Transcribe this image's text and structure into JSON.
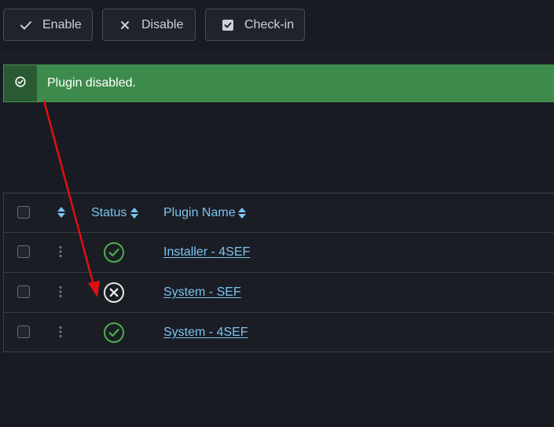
{
  "toolbar": {
    "enable_label": "Enable",
    "disable_label": "Disable",
    "checkin_label": "Check-in"
  },
  "alert": {
    "message": "Plugin disabled.",
    "color": "#3d8b4c"
  },
  "table": {
    "headers": {
      "status": "Status",
      "plugin_name": "Plugin Name"
    },
    "rows": [
      {
        "name": "Installer - 4SEF",
        "status": "enabled",
        "status_icon": "check-circle-icon"
      },
      {
        "name": "System - SEF",
        "status": "disabled",
        "status_icon": "x-circle-icon"
      },
      {
        "name": "System - 4SEF",
        "status": "enabled",
        "status_icon": "check-circle-icon"
      }
    ]
  },
  "colors": {
    "background": "#181b22",
    "link": "#7cc3f2",
    "enabled_icon": "#4caf50",
    "disabled_icon": "#e8e8e8",
    "annotation_arrow": "#e01010"
  }
}
